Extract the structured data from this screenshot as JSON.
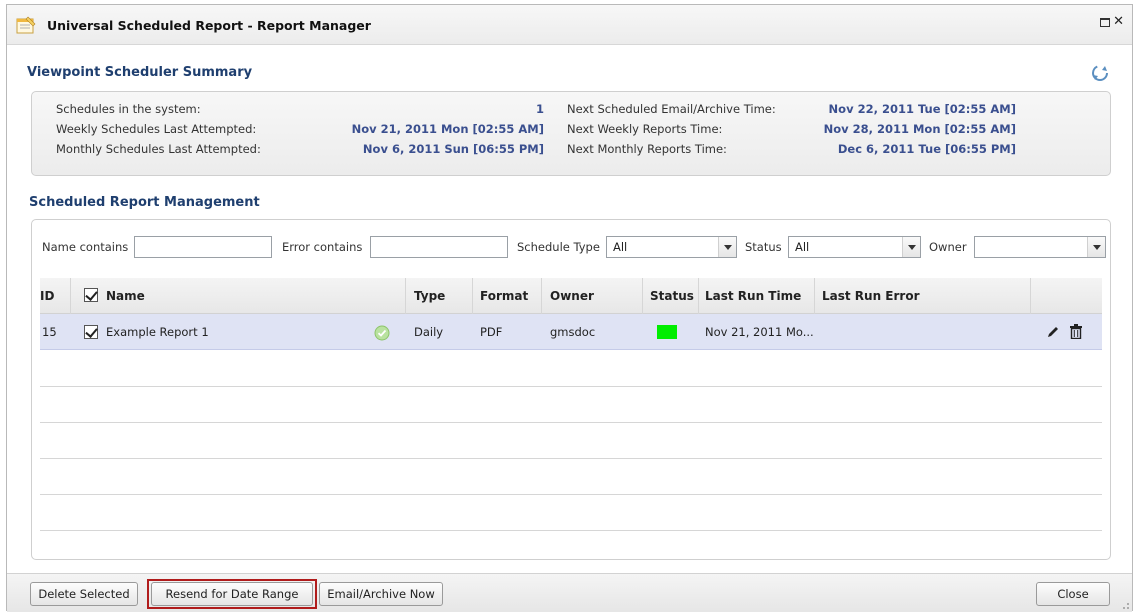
{
  "window": {
    "title": "Universal Scheduled Report - Report Manager"
  },
  "summary": {
    "heading": "Viewpoint Scheduler Summary",
    "left": [
      {
        "label": "Schedules in the system:",
        "value": "1"
      },
      {
        "label": "Weekly Schedules Last Attempted:",
        "value": "Nov 21, 2011 Mon [02:55 AM]"
      },
      {
        "label": "Monthly Schedules Last Attempted:",
        "value": "Nov 6, 2011 Sun [06:55 PM]"
      }
    ],
    "right": [
      {
        "label": "Next Scheduled Email/Archive Time:",
        "value": "Nov 22, 2011 Tue [02:55 AM]"
      },
      {
        "label": "Next Weekly Reports Time:",
        "value": "Nov 28, 2011 Mon [02:55 AM]"
      },
      {
        "label": "Next Monthly Reports Time:",
        "value": "Dec 6, 2011 Tue [06:55 PM]"
      }
    ]
  },
  "management": {
    "heading": "Scheduled Report Management",
    "filters": {
      "name_label": "Name contains",
      "name_value": "",
      "error_label": "Error contains",
      "error_value": "",
      "type_label": "Schedule Type",
      "type_value": "All",
      "status_label": "Status",
      "status_value": "All",
      "owner_label": "Owner",
      "owner_value": ""
    },
    "columns": {
      "id": "ID",
      "name": "Name",
      "type": "Type",
      "format": "Format",
      "owner": "Owner",
      "status": "Status",
      "last_run_time": "Last Run Time",
      "last_run_error": "Last Run Error"
    },
    "rows": [
      {
        "id": "15",
        "name": "Example Report 1",
        "checked": true,
        "type": "Daily",
        "format": "PDF",
        "owner": "gmsdoc",
        "status_color": "#00ee00",
        "last_run_time": "Nov 21, 2011 Mo...",
        "last_run_error": ""
      }
    ]
  },
  "buttons": {
    "delete_selected": "Delete Selected",
    "resend": "Resend for Date Range",
    "email_archive": "Email/Archive Now",
    "close": "Close"
  },
  "colors": {
    "heading": "#1f3f6f",
    "value_text": "#3a4f8f",
    "selected_row": "#dfe3f4",
    "highlight_border": "#b01c1c"
  }
}
